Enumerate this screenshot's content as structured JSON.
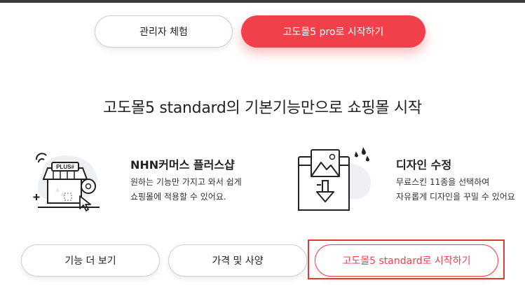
{
  "top_buttons": {
    "admin_trial": "관리자 체험",
    "start_pro": "고도몰5 pro로 시작하기"
  },
  "headline": "고도몰5 standard의 기본기능만으로 쇼핑몰 시작",
  "features": [
    {
      "title": "NHN커머스 플러스샵",
      "desc_line1": "원하는 기능만 가지고 와서 쉽게",
      "desc_line2": "쇼핑몰에 적용할 수 있어요.",
      "icon": "store-icon",
      "icon_sign_text": "PLUS#"
    },
    {
      "title": "디자인 수정",
      "desc_line1": "무료스킨 11종을 선택하여",
      "desc_line2": "자유롭게 디자인을 꾸밀 수 있어요",
      "icon": "design-image-icon"
    }
  ],
  "bottom_buttons": {
    "more_features": "기능 더 보기",
    "pricing": "가격 및 사양",
    "start_standard": "고도몰5 standard로 시작하기"
  },
  "colors": {
    "accent": "#f2404b",
    "highlight_border": "#e53935"
  }
}
